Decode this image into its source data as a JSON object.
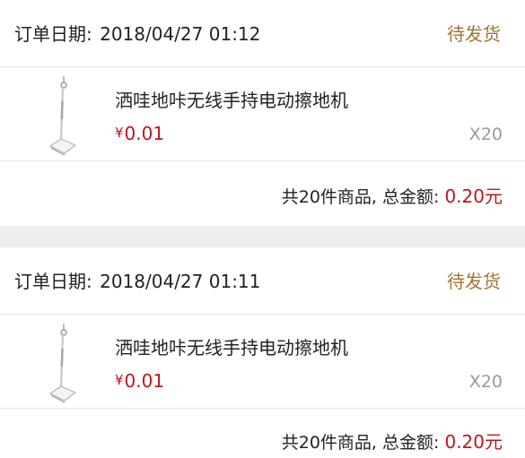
{
  "orders": [
    {
      "date_label": "订单日期:",
      "date_value": "2018/04/27 01:12",
      "status": "待发货",
      "product": {
        "name": "洒哇地咔无线手持电动擦地机",
        "currency": "¥",
        "price": "0.01",
        "quantity": "X20",
        "thumbnail_icon": "mop-icon"
      },
      "summary": {
        "count_text": "共20件商品,",
        "total_label": "总金额:",
        "total_value": "0.20元"
      }
    },
    {
      "date_label": "订单日期:",
      "date_value": "2018/04/27 01:11",
      "status": "待发货",
      "product": {
        "name": "洒哇地咔无线手持电动擦地机",
        "currency": "¥",
        "price": "0.01",
        "quantity": "X20",
        "thumbnail_icon": "mop-icon"
      },
      "summary": {
        "count_text": "共20件商品,",
        "total_label": "总金额:",
        "total_value": "0.20元"
      }
    }
  ],
  "colors": {
    "status": "#a57332",
    "price": "#c0151d",
    "divider": "#e6e6e6",
    "separator": "#eeeeee"
  }
}
